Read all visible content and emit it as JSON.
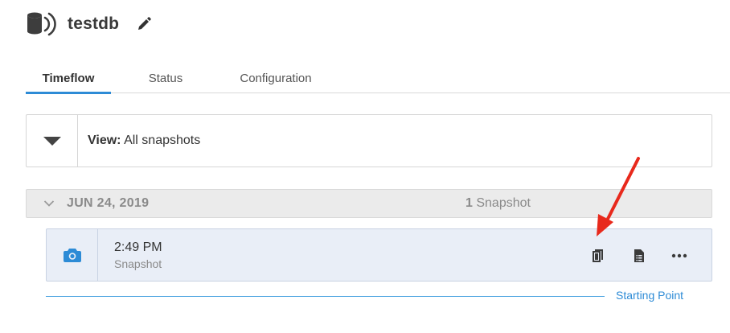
{
  "header": {
    "title": "testdb",
    "db_icon": "database-icon",
    "edit_icon": "pencil-icon"
  },
  "tabs": [
    {
      "label": "Timeflow",
      "active": true
    },
    {
      "label": "Status",
      "active": false
    },
    {
      "label": "Configuration",
      "active": false
    }
  ],
  "view_filter": {
    "label": "View:",
    "value": "All snapshots"
  },
  "group": {
    "date": "JUN 24, 2019",
    "count": "1",
    "count_label": "Snapshot"
  },
  "snapshot": {
    "time": "2:49 PM",
    "type": "Snapshot",
    "icon": "camera-icon",
    "actions": [
      "copy-icon",
      "document-list-icon",
      "more-icon"
    ]
  },
  "starting_point": {
    "label": "Starting Point"
  },
  "colors": {
    "accent": "#2d8bd6",
    "annotation": "#e8291c",
    "row_bg": "#e9eef7"
  }
}
